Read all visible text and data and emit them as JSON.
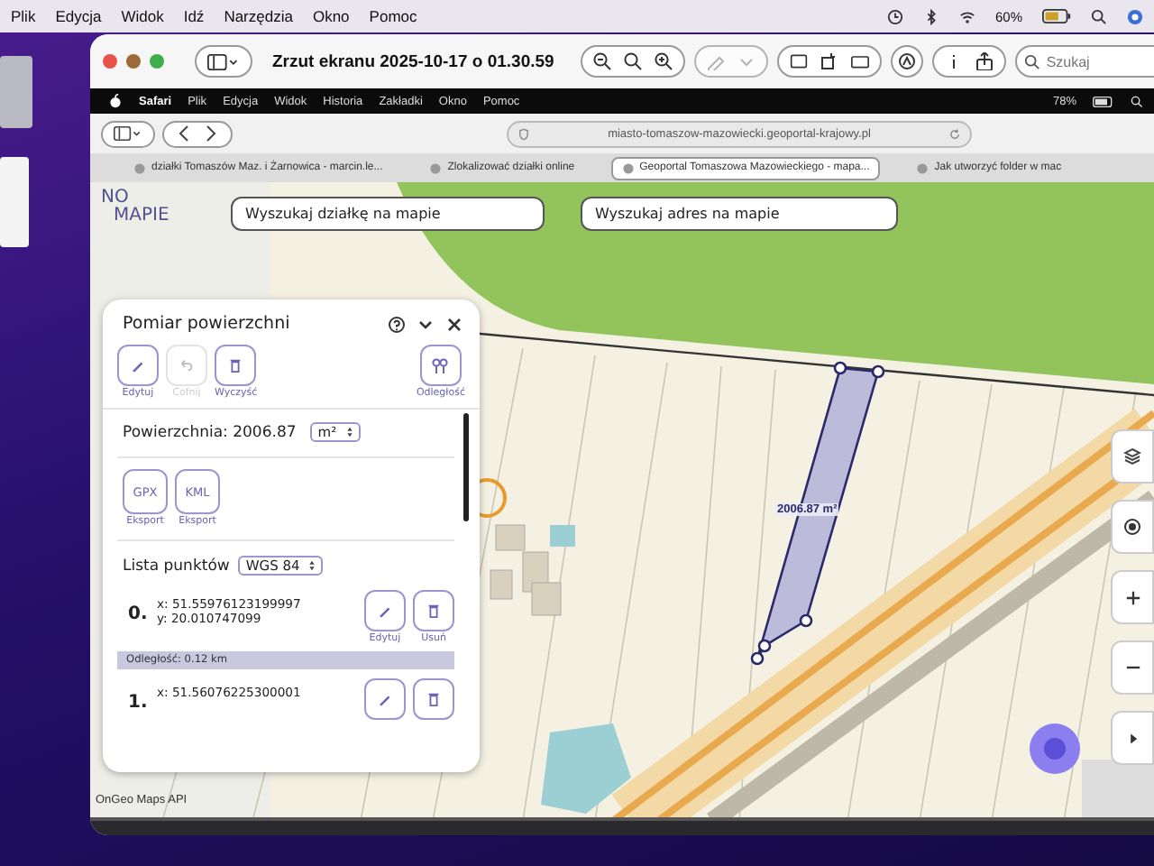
{
  "menubar": {
    "items": [
      "Plik",
      "Edycja",
      "Widok",
      "Idź",
      "Narzędzia",
      "Okno",
      "Pomoc"
    ],
    "battery": "60%"
  },
  "preview_window": {
    "title": "Zrzut ekranu 2025-10-17 o 01.30.59",
    "search": {
      "placeholder": "Szukaj"
    }
  },
  "safari": {
    "menu": [
      "Safari",
      "Plik",
      "Edycja",
      "Widok",
      "Historia",
      "Zakładki",
      "Okno",
      "Pomoc"
    ],
    "battery": "78%",
    "url": "miasto-tomaszow-mazowiecki.geoportal-krajowy.pl",
    "tabs": [
      {
        "label": "działki Tomaszów Maz. i Żarnowica - marcin.le...",
        "selected": false
      },
      {
        "label": "Zlokalizować działki online",
        "selected": false
      },
      {
        "label": "Geoportal Tomaszowa Mazowieckiego - mapa...",
        "selected": true
      },
      {
        "label": "Jak utworzyć folder w mac",
        "selected": false
      }
    ]
  },
  "map": {
    "logo_top": "NO",
    "logo_bottom": "MAPIE",
    "searches": [
      {
        "label": "Wyszukaj działkę na mapie"
      },
      {
        "label": "Wyszukaj adres na mapie"
      }
    ],
    "area_label": "2006.87 m²",
    "attribution": "OnGeo Maps API"
  },
  "panel": {
    "title": "Pomiar powierzchni",
    "tools": [
      {
        "kind": "pencil",
        "label": "Edytuj",
        "disabled": false
      },
      {
        "kind": "undo",
        "label": "Cofnij",
        "disabled": true
      },
      {
        "kind": "trash",
        "label": "Wyczyść",
        "disabled": false
      }
    ],
    "distance_tool": {
      "label": "Odległość"
    },
    "area_label": "Powierzchnia:",
    "area_value": "2006.87",
    "unit": "m²",
    "exports": [
      {
        "format": "GPX",
        "label": "Eksport"
      },
      {
        "format": "KML",
        "label": "Eksport"
      }
    ],
    "points_label": "Lista punktów",
    "crs": "WGS 84",
    "points": [
      {
        "index": "0.",
        "x": "x: 51.55976123199997",
        "y": "y: 20.010747099",
        "edit": "Edytuj",
        "delete": "Usuń",
        "distance": "Odległość: 0.12 km"
      },
      {
        "index": "1.",
        "x": "x: 51.56076225300001"
      }
    ]
  }
}
